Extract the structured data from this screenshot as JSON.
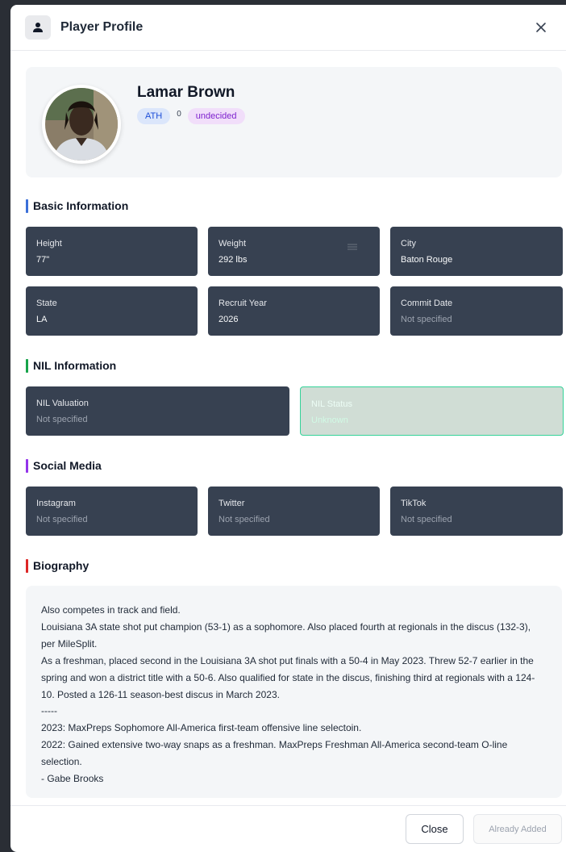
{
  "modal": {
    "title": "Player Profile",
    "close_label": "Close",
    "added_label": "Already Added"
  },
  "player": {
    "name": "Lamar Brown",
    "position": "ATH",
    "number": "0",
    "status": "undecided"
  },
  "sections": {
    "basic": "Basic Information",
    "nil": "NIL Information",
    "social": "Social Media",
    "bio": "Biography"
  },
  "colors": {
    "basic": "#3b6fd8",
    "nil": "#16a34a",
    "social": "#9333ea",
    "bio": "#dc2626"
  },
  "basic_info": [
    {
      "label": "Height",
      "value": "77\""
    },
    {
      "label": "Weight",
      "value": "292 lbs"
    },
    {
      "label": "City",
      "value": "Baton Rouge"
    },
    {
      "label": "State",
      "value": "LA"
    },
    {
      "label": "Recruit Year",
      "value": "2026"
    },
    {
      "label": "Commit Date",
      "value": "Not specified"
    }
  ],
  "nil_info": [
    {
      "label": "NIL Valuation",
      "value": "Not specified"
    },
    {
      "label": "NIL Status",
      "value": "Unknown"
    }
  ],
  "social_media": [
    {
      "label": "Instagram",
      "value": "Not specified"
    },
    {
      "label": "Twitter",
      "value": "Not specified"
    },
    {
      "label": "TikTok",
      "value": "Not specified"
    }
  ],
  "biography": [
    "Also competes in track and field.",
    "Louisiana 3A state shot put champion (53-1) as a sophomore. Also placed fourth at regionals in the discus (132-3), per MileSplit.",
    "As a freshman, placed second in the Louisiana 3A shot put finals with a 50-4 in May 2023. Threw 52-7 earlier in the spring and won a district title with a 50-6. Also qualified for state in the discus, finishing third at regionals with a 124-10. Posted a 126-11 season-best discus in March 2023.",
    "-----",
    "2023: MaxPreps Sophomore All-America first-team offensive line selectoin.",
    "2022: Gained extensive two-way snaps as a freshman. MaxPreps Freshman All-America second-team O-line selection.",
    "- Gabe Brooks"
  ],
  "icons": {
    "header": "user-icon",
    "close": "close-icon",
    "weight_menu": "menu-lines-icon"
  }
}
